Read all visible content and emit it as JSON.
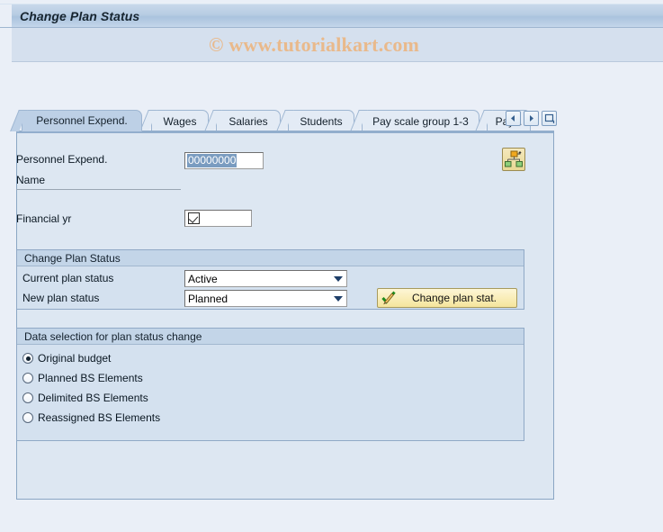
{
  "window": {
    "title": "Change Plan Status"
  },
  "watermark": {
    "text": "© www.tutorialkart.com"
  },
  "tabs": {
    "items": [
      {
        "label": "Personnel Expend.",
        "active": true
      },
      {
        "label": "Wages",
        "active": false
      },
      {
        "label": "Salaries",
        "active": false
      },
      {
        "label": "Students",
        "active": false
      },
      {
        "label": "Pay scale group 1-3",
        "active": false
      },
      {
        "label": "Pay...",
        "active": false
      }
    ],
    "nav": {
      "prev_icon": "left-arrow-icon",
      "next_icon": "right-arrow-icon",
      "list_icon": "tab-list-icon"
    }
  },
  "form": {
    "personnel_expend": {
      "label": "Personnel Expend.",
      "value": "00000000"
    },
    "name": {
      "label": "Name",
      "value": ""
    },
    "financial_yr": {
      "label": "Financial yr",
      "value": "",
      "icon": "checkbox-check-icon"
    },
    "hierarchy_button_icon": "org-structure-icon"
  },
  "change_plan_status_group": {
    "title": "Change Plan Status",
    "current_plan_status": {
      "label": "Current plan status",
      "value": "Active"
    },
    "new_plan_status": {
      "label": "New plan status",
      "value": "Planned"
    },
    "action_button": {
      "label": "Change plan stat.",
      "icon": "check-pencil-icon"
    }
  },
  "data_selection_group": {
    "title": "Data selection for plan status change",
    "options": [
      {
        "label": "Original budget",
        "selected": true
      },
      {
        "label": "Planned BS Elements",
        "selected": false
      },
      {
        "label": "Delimited BS Elements",
        "selected": false
      },
      {
        "label": "Reassigned BS Elements",
        "selected": false
      }
    ]
  },
  "colors": {
    "page_background": "#eaeff7",
    "titlebar": "#b7cce3",
    "panel": "#dde7f2",
    "group_background": "#d4e1ef",
    "group_header": "#c3d5e8",
    "active_tab": "#bdd0e6",
    "watermark": "#e9b98b",
    "button_yellow": "#f5e59c"
  }
}
